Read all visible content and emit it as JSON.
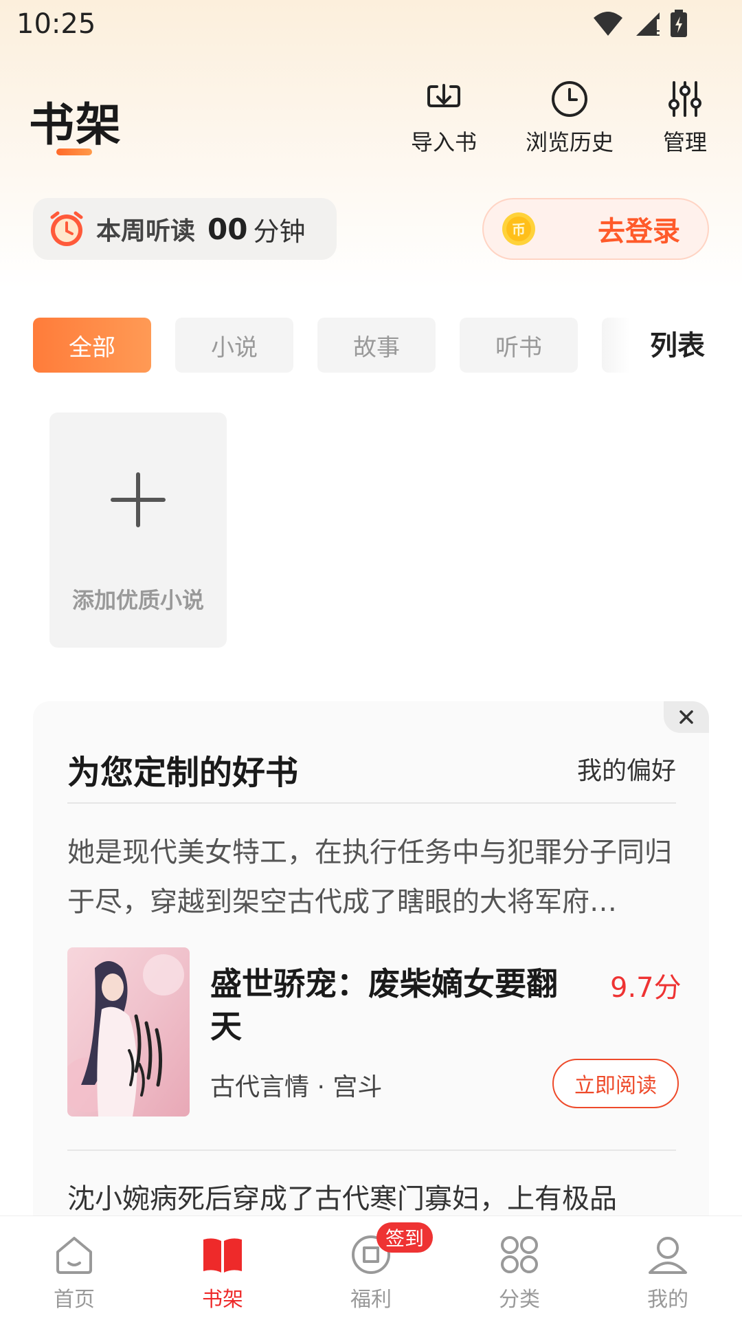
{
  "status_bar": {
    "time": "10:25"
  },
  "header": {
    "title": "书架",
    "actions": [
      {
        "label": "导入书",
        "icon": "import-icon"
      },
      {
        "label": "浏览历史",
        "icon": "clock-icon"
      },
      {
        "label": "管理",
        "icon": "sliders-icon"
      }
    ]
  },
  "listen": {
    "label": "本周听读",
    "minutes": "00",
    "unit": "分钟"
  },
  "login": {
    "label": "去登录"
  },
  "tabs": [
    {
      "label": "全部",
      "active": true
    },
    {
      "label": "小说",
      "active": false
    },
    {
      "label": "故事",
      "active": false
    },
    {
      "label": "听书",
      "active": false
    }
  ],
  "view_toggle": "列表",
  "add_card": {
    "label": "添加优质小说"
  },
  "recommend": {
    "title": "为您定制的好书",
    "preference": "我的偏好",
    "book": {
      "description": "她是现代美女特工，在执行任务中与犯罪分子同归于尽，穿越到架空古代成了瞎眼的大将军府…",
      "title": "盛世骄宠：废柴嫡女要翻天",
      "score": "9.7分",
      "tags": "古代言情 · 宫斗",
      "read_label": "立即阅读"
    },
    "next_description": "沈小婉病死后穿成了古代寒门寡妇，上有极品"
  },
  "bottom_nav": {
    "items": [
      {
        "label": "首页",
        "active": false
      },
      {
        "label": "书架",
        "active": true
      },
      {
        "label": "福利",
        "active": false
      },
      {
        "label": "分类",
        "active": false
      },
      {
        "label": "我的",
        "active": false
      }
    ],
    "badge": "签到"
  },
  "colors": {
    "accent": "#ff6a2a",
    "active_red": "#ee2a2a",
    "score_red": "#ee3333"
  }
}
